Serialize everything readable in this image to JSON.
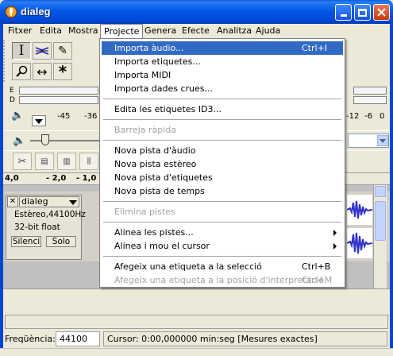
{
  "window": {
    "title": "dialeg"
  },
  "menubar": {
    "items": [
      "Fitxer",
      "Edita",
      "Mostra",
      "Projecte",
      "Genera",
      "Efecte",
      "Analitza",
      "Ajuda"
    ],
    "open_index": 3
  },
  "meter": {
    "left_ticks": [
      "-45",
      "-36"
    ],
    "right_ticks": [
      "-12",
      "-6",
      "0"
    ],
    "rec_labels": [
      "E",
      "D"
    ]
  },
  "ruler": {
    "ticks": [
      "4,0",
      "- 2,0",
      "- 1,0"
    ]
  },
  "track": {
    "name": "dialeg",
    "info_line1": "Estèreo,44100Hz",
    "info_line2": "32-bit float",
    "mute_label": "Silenci",
    "solo_label": "Solo",
    "close_glyph": "✕"
  },
  "status": {
    "freq_label": "Freqüència:",
    "freq_value": "44100",
    "cursor_text": "Cursor: 0:00,000000 min:seg   [Mesures exactes]"
  },
  "dropdown": {
    "items": [
      {
        "label": "Importa àudio...",
        "shortcut": "Ctrl+I",
        "highlighted": true
      },
      {
        "label": "Importa etiquetes..."
      },
      {
        "label": "Importa MIDI"
      },
      {
        "label": "Importa dades crues..."
      },
      {
        "label": "Edita les etiquetes ID3..."
      },
      {
        "label": "Barreja ràpida",
        "disabled": true
      },
      {
        "label": "Nova pista d'àudio"
      },
      {
        "label": "Nova pista estèreo"
      },
      {
        "label": "Nova pista d'etiquetes"
      },
      {
        "label": "Nova pista de temps"
      },
      {
        "label": "Elimina pistes",
        "disabled": true
      },
      {
        "label": "Alinea les pistes...",
        "submenu": true
      },
      {
        "label": "Alinea i mou el cursor",
        "submenu": true
      },
      {
        "label": "Afegeix una etiqueta a la selecció",
        "shortcut": "Ctrl+B"
      },
      {
        "label": "Afegeix una etiqueta a la posició d'interpretació",
        "shortcut": "Ctrl+M",
        "disabled": true
      }
    ]
  },
  "colors": {
    "titlebar": "#0058e6",
    "highlight": "#316ac5",
    "waveform": "#3232c8"
  }
}
